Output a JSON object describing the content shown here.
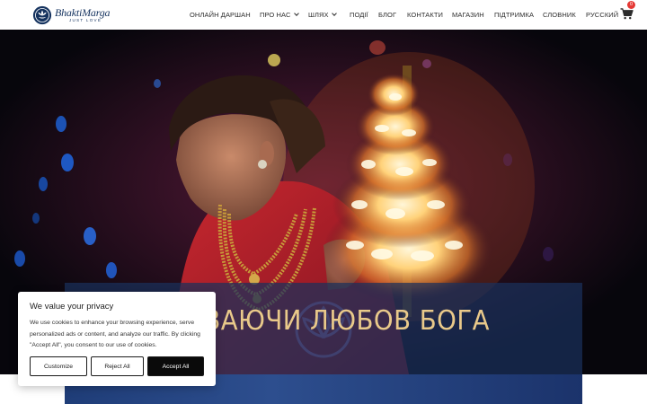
{
  "brand": {
    "name": "BhaktiMarga",
    "tagline": "JUST LOVE"
  },
  "nav": {
    "items": [
      {
        "label": "ОНЛАЙН ДАРШАН",
        "has_dropdown": false
      },
      {
        "label": "ПРО НАС",
        "has_dropdown": true
      },
      {
        "label": "ШЛЯХ",
        "has_dropdown": true
      },
      {
        "label": "ПОДІЇ",
        "has_dropdown": false
      },
      {
        "label": "БЛОГ",
        "has_dropdown": false
      },
      {
        "label": "КОНТАКТИ",
        "has_dropdown": false
      },
      {
        "label": "МАГАЗИН",
        "has_dropdown": false
      },
      {
        "label": "ПІДТРИМКА",
        "has_dropdown": false
      },
      {
        "label": "СЛОВНИК",
        "has_dropdown": false
      },
      {
        "label": "РУССКИЙ",
        "has_dropdown": false
      }
    ],
    "cart_count": "0",
    "cart_icon": "shopping-cart-icon"
  },
  "hero": {
    "title": "ЖИВАЮЧИ ЛЮБОВ БОГА",
    "title_color": "#e9c98a",
    "band_color": "#1a305c"
  },
  "cookie": {
    "title": "We value your privacy",
    "text": "We use cookies to enhance your browsing experience, serve personalized ads or content, and analyze our traffic. By clicking \"Accept All\", you consent to our use of cookies.",
    "buttons": {
      "customize": "Customize",
      "reject": "Reject All",
      "accept": "Accept All"
    }
  },
  "colors": {
    "brand_navy": "#15335f",
    "accent_red": "#e53935"
  }
}
